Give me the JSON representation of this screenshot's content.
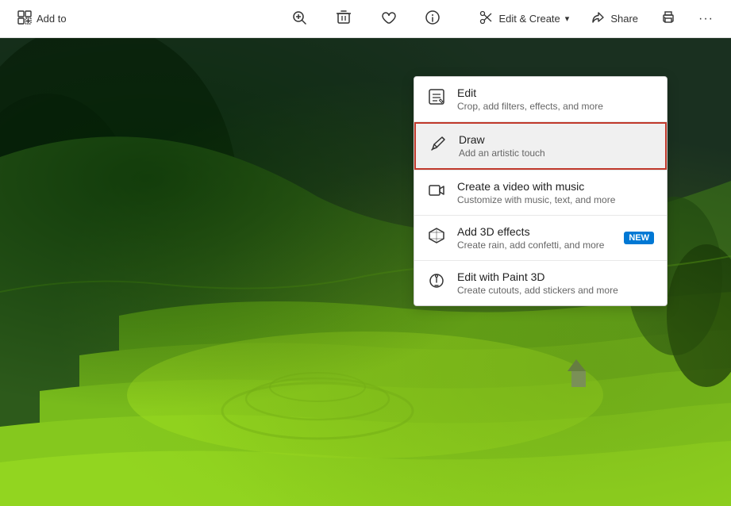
{
  "toolbar": {
    "add_to_label": "Add to",
    "share_label": "Share",
    "edit_create_label": "Edit & Create",
    "chevron_down": "▾",
    "more_options": "···"
  },
  "menu": {
    "items": [
      {
        "id": "edit",
        "title": "Edit",
        "desc": "Crop, add filters, effects, and more",
        "selected": false,
        "new_badge": false
      },
      {
        "id": "draw",
        "title": "Draw",
        "desc": "Add an artistic touch",
        "selected": true,
        "new_badge": false
      },
      {
        "id": "video",
        "title": "Create a video with music",
        "desc": "Customize with music, text, and more",
        "selected": false,
        "new_badge": false
      },
      {
        "id": "3d",
        "title": "Add 3D effects",
        "desc": "Create rain, add confetti, and more",
        "selected": false,
        "new_badge": true,
        "badge_text": "NEW"
      },
      {
        "id": "paint3d",
        "title": "Edit with Paint 3D",
        "desc": "Create cutouts, add stickers and more",
        "selected": false,
        "new_badge": false
      }
    ]
  }
}
